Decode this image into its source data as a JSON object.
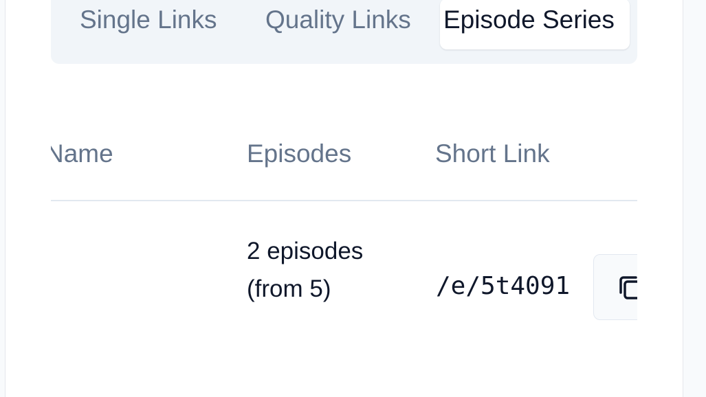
{
  "tabs": [
    {
      "label": "Single Links",
      "active": false
    },
    {
      "label": "Quality Links",
      "active": false
    },
    {
      "label": "Episode Series",
      "active": true
    }
  ],
  "table": {
    "columns": {
      "name": "Name",
      "episodes": "Episodes",
      "short_link": "Short Link"
    },
    "rows": [
      {
        "name": "",
        "episodes": "2 episodes (from 5)",
        "short_link": "/e/5t4091",
        "action_icon": "copy-icon"
      }
    ]
  },
  "colors": {
    "muted_text": "#64748b",
    "primary_text": "#0f172a",
    "tab_bar_bg": "#f1f5f9",
    "border": "#e2e8f0"
  }
}
